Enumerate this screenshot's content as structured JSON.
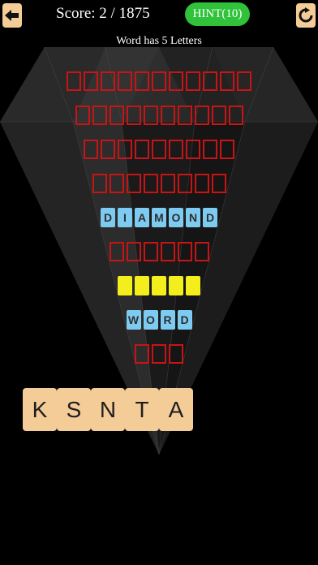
{
  "header": {
    "back_icon": "arrow-left-icon",
    "score_label": "Score:",
    "score_value": "2",
    "score_total": "1875",
    "hint_label": "HINT(10)",
    "refresh_icon": "refresh-icon"
  },
  "word_info": "Word has 5 Letters",
  "colors": {
    "empty_border": "#c81414",
    "solved_fill": "#7ecbf1",
    "active_fill": "#f4ee1c",
    "tile_fill": "#f4cc98",
    "hint_fill": "#2fc23a"
  },
  "puzzle_rows": [
    {
      "state": "empty",
      "letters": [
        "",
        "",
        "",
        "",
        "",
        "",
        "",
        "",
        "",
        "",
        ""
      ]
    },
    {
      "state": "empty",
      "letters": [
        "",
        "",
        "",
        "",
        "",
        "",
        "",
        "",
        "",
        ""
      ]
    },
    {
      "state": "empty",
      "letters": [
        "",
        "",
        "",
        "",
        "",
        "",
        "",
        "",
        ""
      ]
    },
    {
      "state": "empty",
      "letters": [
        "",
        "",
        "",
        "",
        "",
        "",
        "",
        ""
      ]
    },
    {
      "state": "solved",
      "letters": [
        "D",
        "I",
        "A",
        "M",
        "O",
        "N",
        "D"
      ]
    },
    {
      "state": "empty",
      "letters": [
        "",
        "",
        "",
        "",
        "",
        ""
      ]
    },
    {
      "state": "active",
      "letters": [
        "",
        "",
        "",
        "",
        ""
      ]
    },
    {
      "state": "solved",
      "letters": [
        "W",
        "O",
        "R",
        "D"
      ]
    },
    {
      "state": "empty",
      "letters": [
        "",
        "",
        ""
      ]
    }
  ],
  "letter_tiles": [
    "K",
    "S",
    "N",
    "T",
    "A"
  ]
}
